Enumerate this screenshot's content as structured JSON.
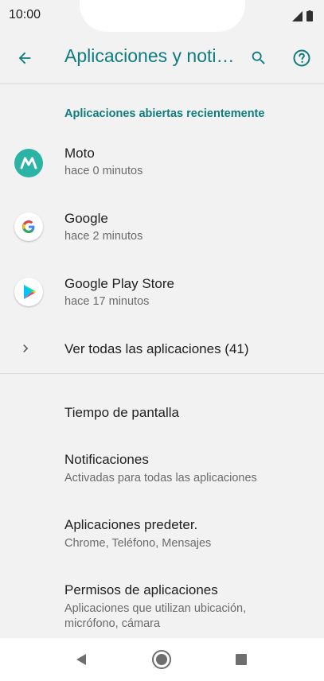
{
  "status_bar": {
    "time": "10:00"
  },
  "app_bar": {
    "title": "Aplicaciones y noti…"
  },
  "recent": {
    "header": "Aplicaciones abiertas recientemente",
    "apps": [
      {
        "name": "Moto",
        "time": "hace 0 minutos",
        "icon": "moto-icon"
      },
      {
        "name": "Google",
        "time": "hace 2 minutos",
        "icon": "google-icon"
      },
      {
        "name": "Google Play Store",
        "time": "hace 17 minutos",
        "icon": "play-store-icon"
      }
    ],
    "see_all": "Ver todas las aplicaciones (41)"
  },
  "settings": [
    {
      "title": "Tiempo de pantalla"
    },
    {
      "title": "Notificaciones",
      "subtitle": "Activadas para todas las aplicaciones"
    },
    {
      "title": "Aplicaciones predeter.",
      "subtitle": "Chrome, Teléfono, Mensajes"
    },
    {
      "title": "Permisos de aplicaciones",
      "subtitle_line1": "Aplicaciones que utilizan ubicación,",
      "subtitle_line2": "micrófono, cámara"
    }
  ],
  "colors": {
    "accent": "#0f7d7f",
    "background": "#f2f2f2"
  }
}
